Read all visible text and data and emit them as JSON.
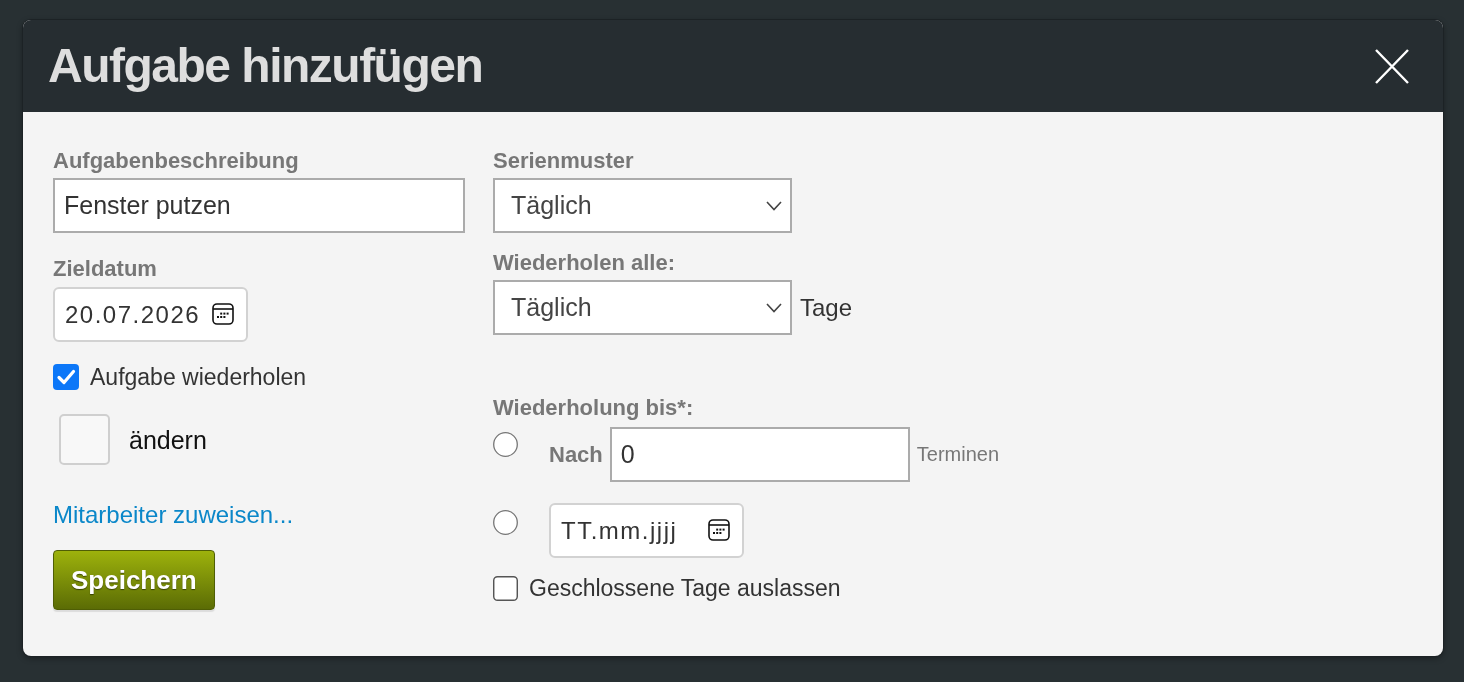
{
  "dialog": {
    "title": "Aufgabe hinzufügen"
  },
  "task_description": {
    "label": "Aufgabenbeschreibung",
    "value": "Fenster putzen"
  },
  "due_date": {
    "label": "Zieldatum",
    "value": "20.07.2026"
  },
  "repeat_task": {
    "label": "Aufgabe wiederholen",
    "checked": true
  },
  "change": {
    "label": "ändern",
    "checked": false
  },
  "assign_link": "Mitarbeiter zuweisen...",
  "save_button": "Speichern",
  "pattern": {
    "label": "Serienmuster",
    "value": "Täglich"
  },
  "repeat_every": {
    "label": "Wiederholen alle:",
    "value": "Täglich",
    "unit": "Tage"
  },
  "repeat_until": {
    "label": "Wiederholung bis*:",
    "options": [
      {
        "kind": "count",
        "selected": false,
        "label": "Nach",
        "value": "0",
        "unit": "Terminen"
      },
      {
        "kind": "date",
        "selected": false,
        "placeholder": "TT.mm.jjjj"
      }
    ]
  },
  "skip_closed": {
    "label": "Geschlossene Tage auslassen",
    "checked": false
  }
}
